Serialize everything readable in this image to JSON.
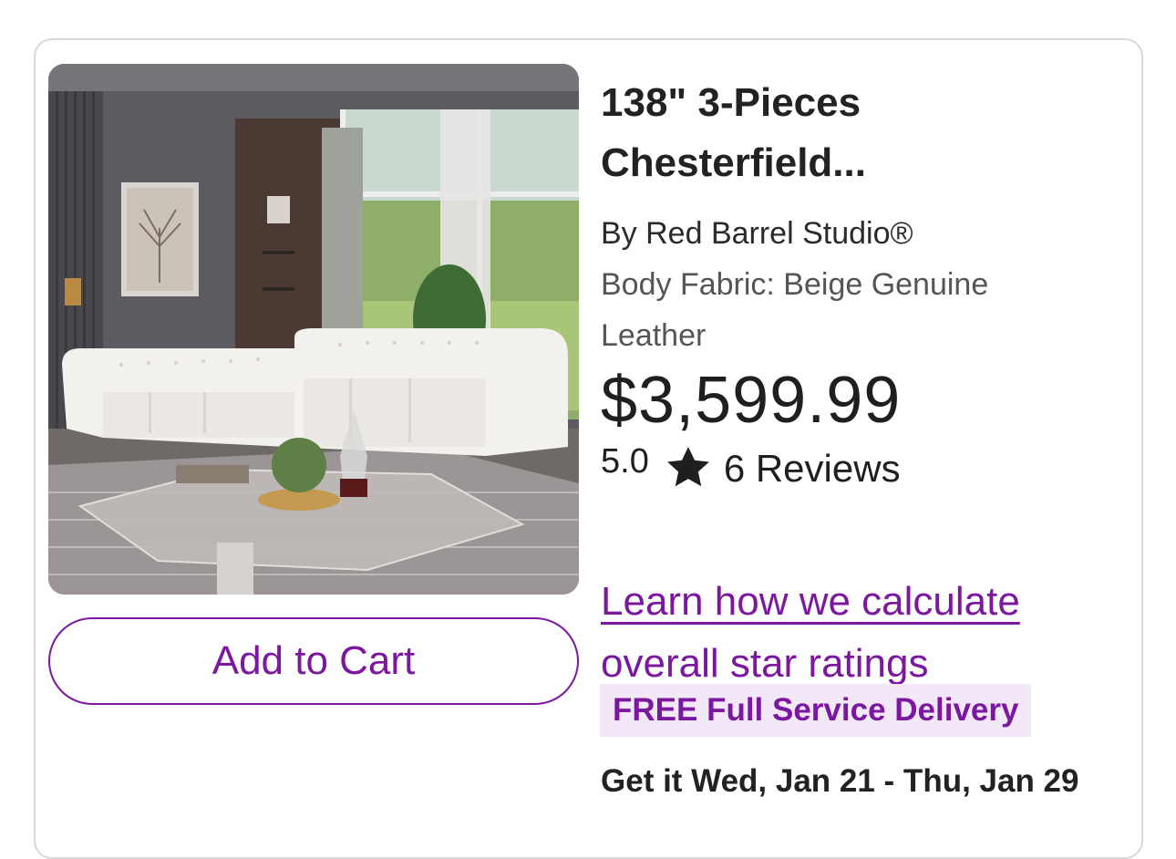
{
  "product": {
    "title_line1": "138\" 3-Pieces",
    "title_line2": "Chesterfield...",
    "brand": "By Red Barrel Studio®",
    "variant_line1": "Body Fabric: Beige Genuine",
    "variant_line2": "Leather",
    "price": "$3,599.99",
    "rating": "5.0",
    "rating_value": 5.0,
    "reviews": "6 Reviews",
    "image_icon": "product-photo-sectional-sofa"
  },
  "actions": {
    "add_to_cart": "Add to Cart",
    "learn_link": "Learn how we calculate overall star ratings"
  },
  "delivery": {
    "badge": "FREE Full Service Delivery",
    "eta": "Get it Wed, Jan 21 - Thu, Jan 29"
  },
  "colors": {
    "accent": "#7b189f",
    "badge_bg": "#f3e8f8",
    "border": "#d9d9d9"
  }
}
